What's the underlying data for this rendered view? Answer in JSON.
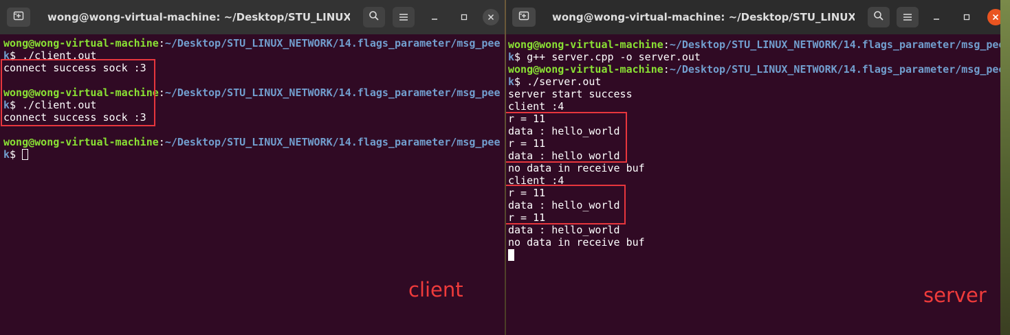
{
  "left_terminal": {
    "title": "wong@wong-virtual-machine: ~/Desktop/STU_LINUX_NETW...",
    "lines": [
      {
        "user": "wong@wong-virtual-machine",
        "colon": ":",
        "path": "~/Desktop/STU_LINUX_NETWORK/14.flags_parameter/msg_pee"
      },
      {
        "wrap": "k",
        "cmd": "$ ./client.out"
      },
      {
        "text": "connect success sock :3"
      },
      {
        "user": "wong@wong-virtual-machine",
        "colon": ":",
        "path": "~/Desktop/STU_LINUX_NETWORK/14.flags_parameter/msg_pee"
      },
      {
        "wrap": "k",
        "cmd": "$ ./client.out"
      },
      {
        "text": "connect success sock :3"
      },
      {
        "user": "wong@wong-virtual-machine",
        "colon": ":",
        "path": "~/Desktop/STU_LINUX_NETWORK/14.flags_parameter/msg_pee"
      },
      {
        "wrap": "k",
        "cmd": "$ "
      }
    ],
    "caption": "client"
  },
  "right_terminal": {
    "title": "wong@wong-virtual-machine: ~/Desktop/STU_LINUX_NETW...",
    "lines": [
      {
        "user": "wong@wong-virtual-machine",
        "colon": ":",
        "path": "~/Desktop/STU_LINUX_NETWORK/14.flags_parameter/msg_pee"
      },
      {
        "wrap": "k",
        "cmd": "$ g++ server.cpp -o server.out"
      },
      {
        "user": "wong@wong-virtual-machine",
        "colon": ":",
        "path": "~/Desktop/STU_LINUX_NETWORK/14.flags_parameter/msg_pee"
      },
      {
        "wrap": "k",
        "cmd": "$ ./server.out"
      },
      {
        "text": "server start success"
      },
      {
        "text": "client :4"
      },
      {
        "text": "r = 11"
      },
      {
        "text": "data : hello_world"
      },
      {
        "text": "r = 11"
      },
      {
        "text": "data : hello_world"
      },
      {
        "text": "no data in receive buf"
      },
      {
        "text": "client :4"
      },
      {
        "text": "r = 11"
      },
      {
        "text": "data : hello_world"
      },
      {
        "text": "r = 11"
      },
      {
        "text": "data : hello_world"
      },
      {
        "text": "no data in receive buf"
      }
    ],
    "caption": "server"
  },
  "icons": {
    "new_tab": "new-tab-icon",
    "search": "search-icon",
    "menu": "hamburger-menu-icon",
    "minimize": "minimize-icon",
    "maximize": "maximize-icon",
    "close": "close-icon"
  },
  "colors": {
    "terminal_bg": "#300a24",
    "user_green": "#8ae234",
    "path_blue": "#729fcf",
    "highlight_red": "#e8363d",
    "close_orange": "#e95420"
  }
}
